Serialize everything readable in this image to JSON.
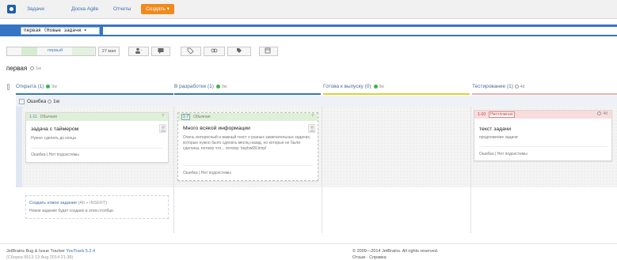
{
  "nav": {
    "items": [
      "Задачи",
      "Доска Agile",
      "Отчеты"
    ],
    "create_label": "Создать ▾"
  },
  "search": {
    "chip": "первая (Новые задачи ▾",
    "value": ""
  },
  "toolbar": {
    "sprint_selected": "первый",
    "date": "27 мая",
    "icons": [
      "user-icon",
      "comment-icon",
      "tag-icon",
      "link-icon",
      "tag-icon",
      "calendar-icon"
    ]
  },
  "sprint": {
    "title": "первая",
    "time": "1w"
  },
  "columns": [
    {
      "title": "Открыта (1)",
      "estimate": "0w",
      "color": "#3575c3"
    },
    {
      "title": "В разработке (1)",
      "estimate": "0w",
      "color": "#3575c3"
    },
    {
      "title": "Готова к выпуску (0)",
      "estimate": "0w",
      "color": "#d7d23a"
    },
    {
      "title": "Тестирование (1)",
      "estimate": "4d",
      "color": "#e7b3b3"
    }
  ],
  "swimlane": {
    "title": "Ошибка",
    "time": "1w"
  },
  "cards": [
    {
      "id": "1-11",
      "type": "Обычная",
      "flag": "?",
      "title": "задача с таймером",
      "desc": "Нужно сделать до конца",
      "foot": "Ошибка | Нет подсистемы",
      "color": "#dff0d8"
    },
    {
      "id": "1-7",
      "type": "Обычная",
      "flag": "?",
      "title": "Много всякой информации",
      "desc": "Очень интересный и важный текст о разных замечательных задачах, которые нужно было сделать месяц назад, но которые не были сделаны, потому что... потому: baybw08.bmp!",
      "foot": "Ошибка | Нет подсистемы",
      "color": "#dff0d8"
    },
    {
      "id": "1-10",
      "type": "Неотложная",
      "flag": "4d",
      "title": "текст задачи",
      "desc": "продолжение задачи",
      "foot": "Ошибка | Нет подсистемы",
      "color": "#f9dcdc"
    }
  ],
  "new_task": {
    "link": "Создать новое задание",
    "shortcut": "(Alt + INSERT)",
    "hint": "Новое задание будет создано в этом столбце."
  },
  "footer": {
    "left1_prefix": "JetBrains Bug & Issue Tracker",
    "left1_link": "YouTrack 5.2.4",
    "left2": "(Сборка 9513 13 Aug 2014 21:38)",
    "right1": "© 2009—2014 JetBrains. All rights reserved.",
    "right2": "Отзыв · Справка"
  }
}
